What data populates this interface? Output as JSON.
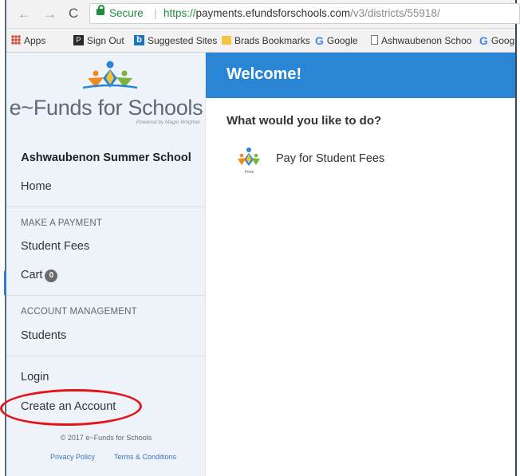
{
  "browser": {
    "secure_label": "Secure",
    "url_proto": "https://",
    "url_host": "payments.efundsforschools.com",
    "url_path": "/v3/districts/55918/",
    "bookmarks": [
      "Apps",
      "Sign Out",
      "Suggested Sites",
      "Brads Bookmarks",
      "Google",
      "Ashwaubenon Schoo",
      "Goog"
    ]
  },
  "sidebar": {
    "logo_text": "e~Funds for Schools",
    "logo_sub": "Powered by Magic-Wrighter",
    "school_name": "Ashwaubenon Summer School",
    "home": "Home",
    "make_payment_head": "MAKE A PAYMENT",
    "student_fees": "Student Fees",
    "cart": "Cart",
    "cart_count": "0",
    "account_head": "ACCOUNT MANAGEMENT",
    "students": "Students",
    "login": "Login",
    "create_account": "Create an Account",
    "copyright": "© 2017 e~Funds for Schools",
    "privacy": "Privacy Policy",
    "terms": "Terms & Conditions"
  },
  "main": {
    "welcome": "Welcome!",
    "question": "What would you like to do?",
    "option_label": "Pay for Student Fees",
    "option_sub": "Fees"
  },
  "colors": {
    "accent": "#2a86d5",
    "sidebar_bg": "#eef3f9",
    "annotation": "#e3141a"
  },
  "icons": [
    "back-arrow-icon",
    "forward-arrow-icon",
    "reload-icon",
    "lock-icon",
    "apps-icon",
    "bing-icon",
    "folder-icon",
    "google-icon",
    "page-icon",
    "efunds-logo-icon",
    "fees-icon"
  ]
}
